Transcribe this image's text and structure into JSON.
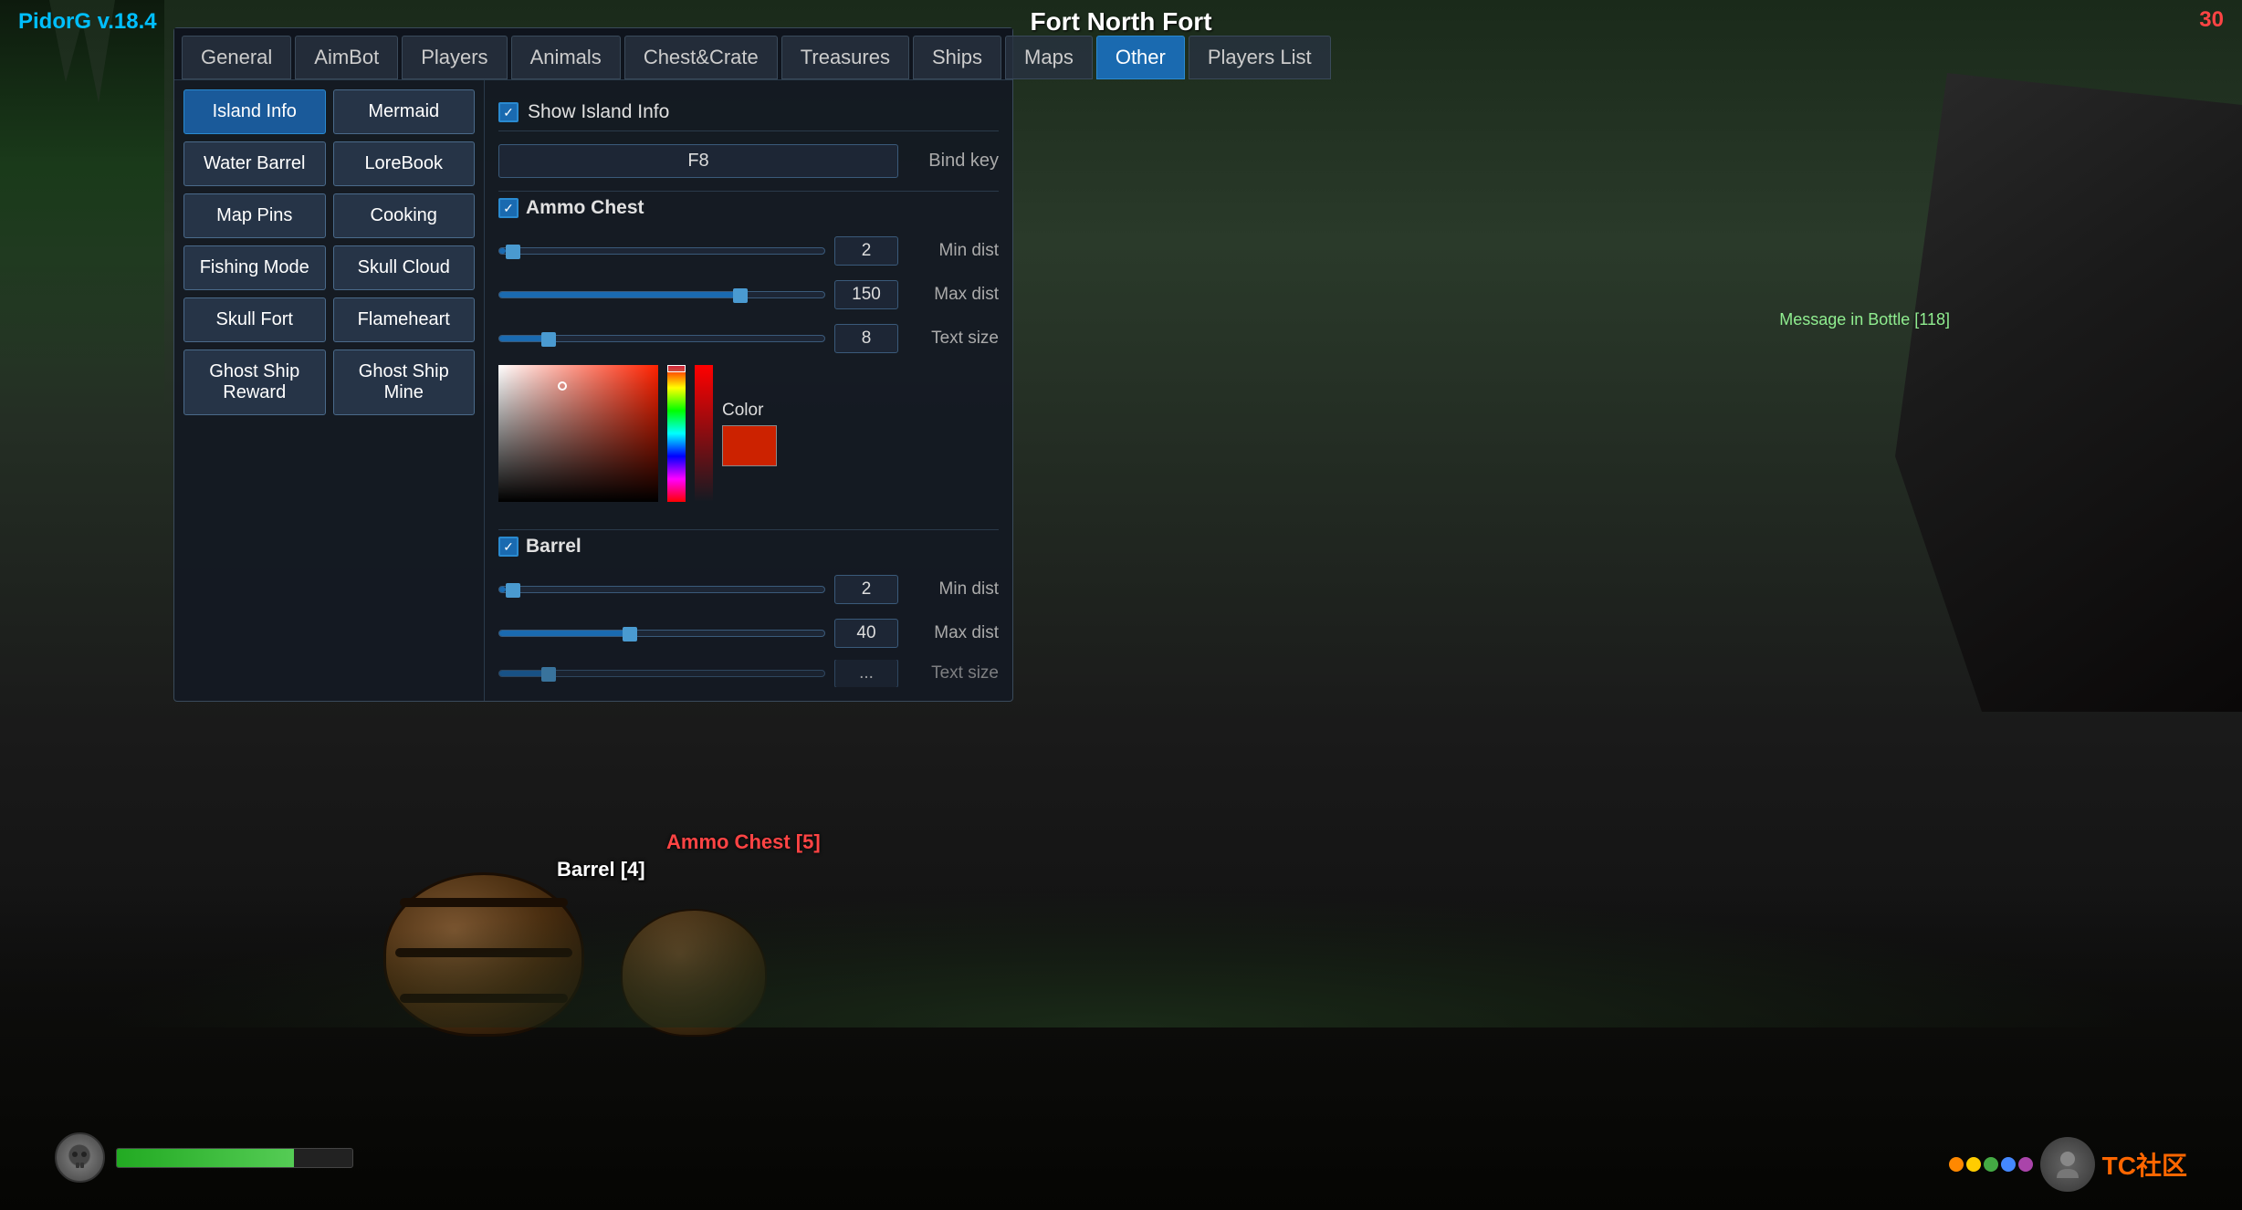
{
  "app": {
    "version": "PidorG v.18.4",
    "title": "Fort North Fort",
    "corner_num": "30"
  },
  "tabs": [
    {
      "id": "general",
      "label": "General",
      "active": false
    },
    {
      "id": "aimbot",
      "label": "AimBot",
      "active": false
    },
    {
      "id": "players",
      "label": "Players",
      "active": false
    },
    {
      "id": "animals",
      "label": "Animals",
      "active": false
    },
    {
      "id": "chest_crate",
      "label": "Chest&Crate",
      "active": false
    },
    {
      "id": "treasures",
      "label": "Treasures",
      "active": false
    },
    {
      "id": "ships",
      "label": "Ships",
      "active": false
    },
    {
      "id": "maps",
      "label": "Maps",
      "active": false
    },
    {
      "id": "other",
      "label": "Other",
      "active": true
    },
    {
      "id": "players_list",
      "label": "Players List",
      "active": false
    }
  ],
  "sidebar": {
    "items": [
      [
        {
          "label": "Island Info",
          "active": true
        },
        {
          "label": "Mermaid",
          "active": false
        }
      ],
      [
        {
          "label": "Water Barrel",
          "active": false
        },
        {
          "label": "LoreBook",
          "active": false
        }
      ],
      [
        {
          "label": "Map Pins",
          "active": false
        },
        {
          "label": "Cooking",
          "active": false
        }
      ],
      [
        {
          "label": "Fishing Mode",
          "active": false
        },
        {
          "label": "Skull Cloud",
          "active": false
        }
      ],
      [
        {
          "label": "Skull Fort",
          "active": false
        },
        {
          "label": "Flameheart",
          "active": false
        }
      ],
      [
        {
          "label": "Ghost Ship Reward",
          "active": false
        },
        {
          "label": "Ghost Ship Mine",
          "active": false
        }
      ]
    ]
  },
  "island_info": {
    "show_label": "Show Island Info",
    "bind_key_value": "F8",
    "bind_key_label": "Bind key"
  },
  "ammo_chest": {
    "section_label": "Ammo Chest",
    "min_dist_value": "2",
    "min_dist_label": "Min dist",
    "max_dist_value": "150",
    "max_dist_label": "Max dist",
    "text_size_value": "8",
    "text_size_label": "Text size",
    "color_label": "Color"
  },
  "barrel_section": {
    "section_label": "Barrel",
    "min_dist_value": "2",
    "min_dist_label": "Min dist",
    "max_dist_value": "40",
    "max_dist_label": "Max dist",
    "text_size_label": "Text size"
  },
  "color_picker": {
    "label": "Color",
    "preview_color": "#cc2200"
  },
  "world_labels": {
    "barrel": "Barrel [4]",
    "ammo_chest": "Ammo Chest [5]"
  },
  "message_bottle": {
    "text": "Message in Bottle [118]"
  },
  "health": {
    "value": 75
  },
  "watermark": {
    "tc_text": "TC社区"
  }
}
